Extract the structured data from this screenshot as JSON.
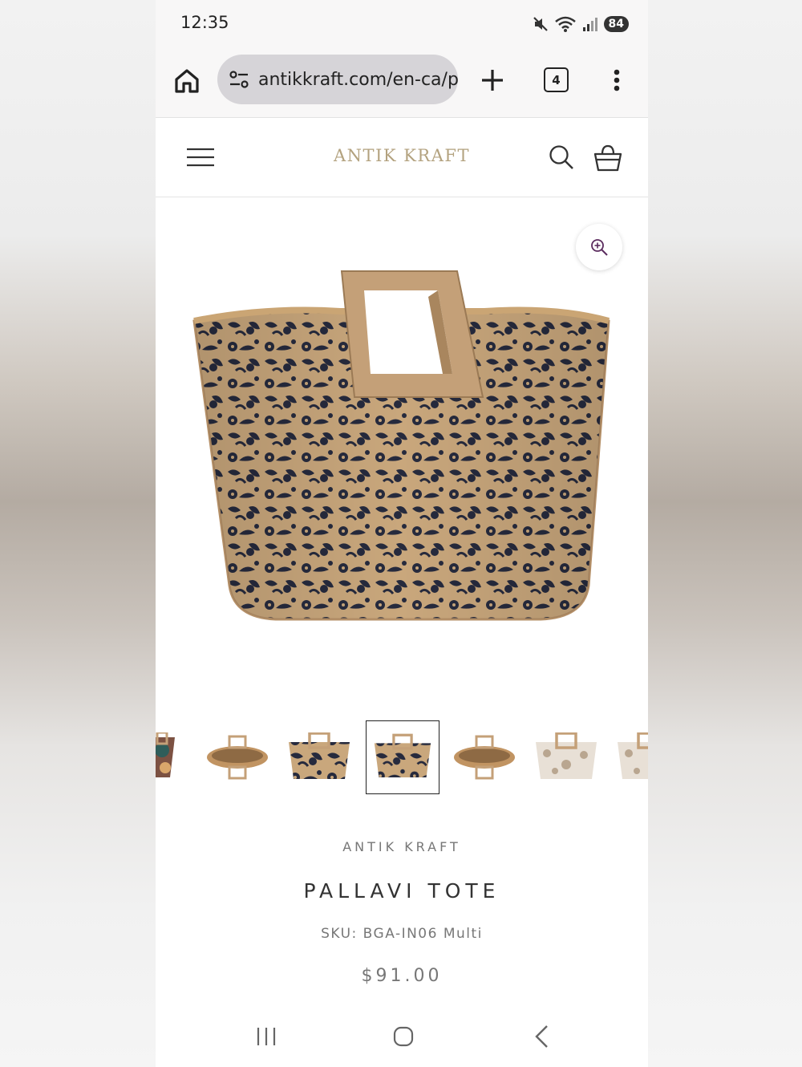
{
  "status_bar": {
    "time": "12:35",
    "battery": "84",
    "icons": [
      "mute-icon",
      "wifi-icon",
      "signal-icon",
      "battery-icon"
    ]
  },
  "browser": {
    "url": "antikkraft.com/en-ca/p",
    "tab_count": "4",
    "icons": [
      "home-icon",
      "site-settings-icon",
      "new-tab-icon",
      "more-vert-icon"
    ]
  },
  "site_header": {
    "logo": "ANTIK KRAFT",
    "icons": [
      "menu-icon",
      "search-icon",
      "basket-icon"
    ]
  },
  "gallery": {
    "zoom_icon": "zoom-in-icon",
    "thumbnails": [
      {
        "variant": "multicolor",
        "view": "front-partial"
      },
      {
        "variant": "natural-black",
        "view": "top"
      },
      {
        "variant": "natural-black",
        "view": "front"
      },
      {
        "variant": "natural-black",
        "view": "front",
        "selected": true
      },
      {
        "variant": "natural-black",
        "view": "top"
      },
      {
        "variant": "white",
        "view": "front"
      },
      {
        "variant": "white",
        "view": "front-partial"
      }
    ]
  },
  "product": {
    "brand": "ANTIK KRAFT",
    "title": "PALLAVI TOTE",
    "sku": "SKU: BGA-IN06 Multi",
    "price": "$91.00"
  },
  "colors": {
    "logo": "#b3a27f",
    "straw": "#c9a77c",
    "pattern": "#262a3d",
    "handle": "#c4a078"
  },
  "nav_bar": {
    "icons": [
      "recent-apps-icon",
      "home-circle-icon",
      "back-icon"
    ]
  }
}
